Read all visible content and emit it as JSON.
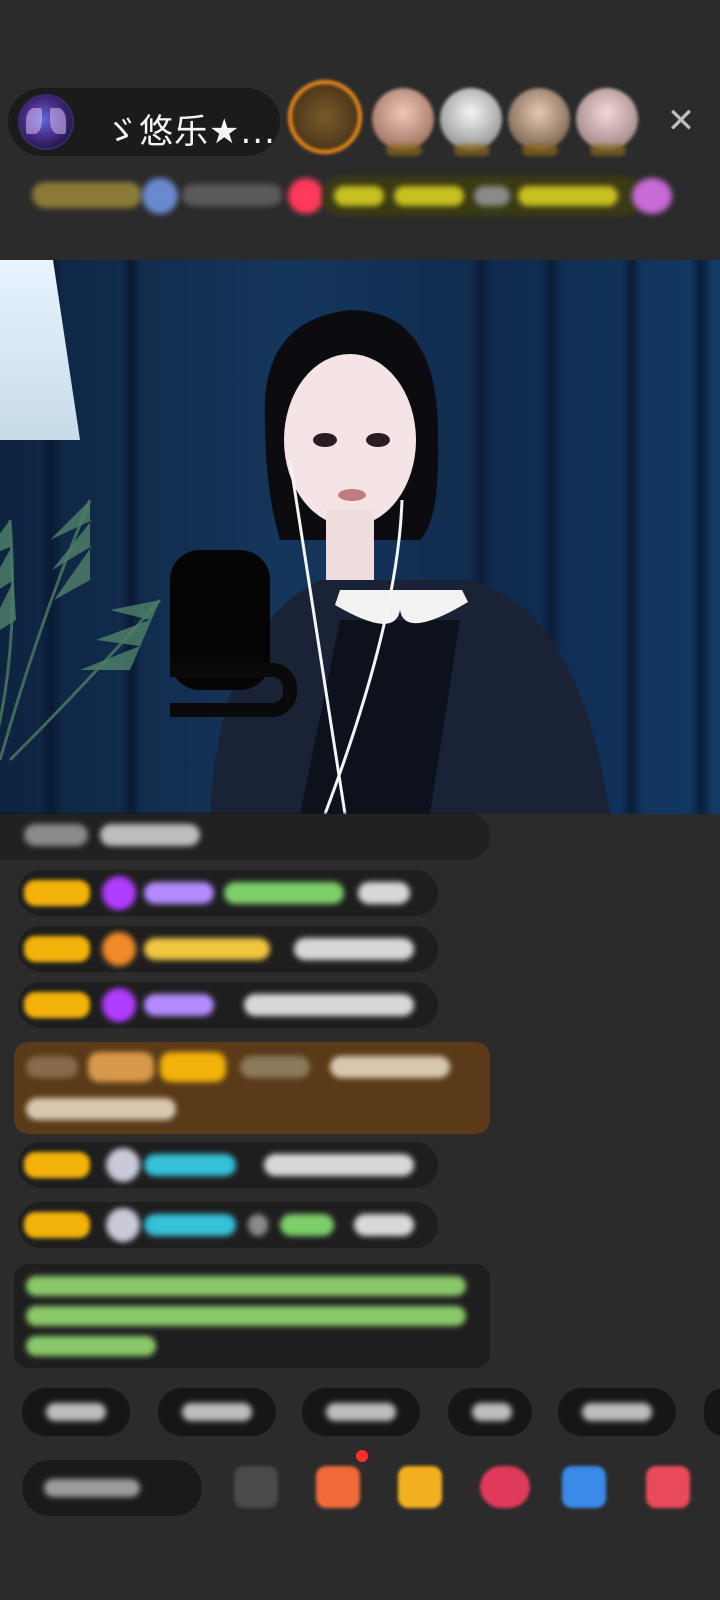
{
  "header": {
    "host_name": "ゞ悠乐★...",
    "close_glyph": "✕"
  },
  "icons": {
    "close": "close-icon",
    "gift": "gift-icon",
    "share": "share-icon",
    "more": "more-icon"
  },
  "colors": {
    "background": "#2b2b2b",
    "pill": "#1b1b1b",
    "badge_gold": "#f2b20a",
    "gift_card": "#5a3a18",
    "chat_name_purple": "#b38bff",
    "chat_name_green": "#7ccf6a",
    "chat_name_teal": "#35c1d8",
    "chat_name_yellow": "#f0c640",
    "accent_red": "#ff2d2d"
  }
}
